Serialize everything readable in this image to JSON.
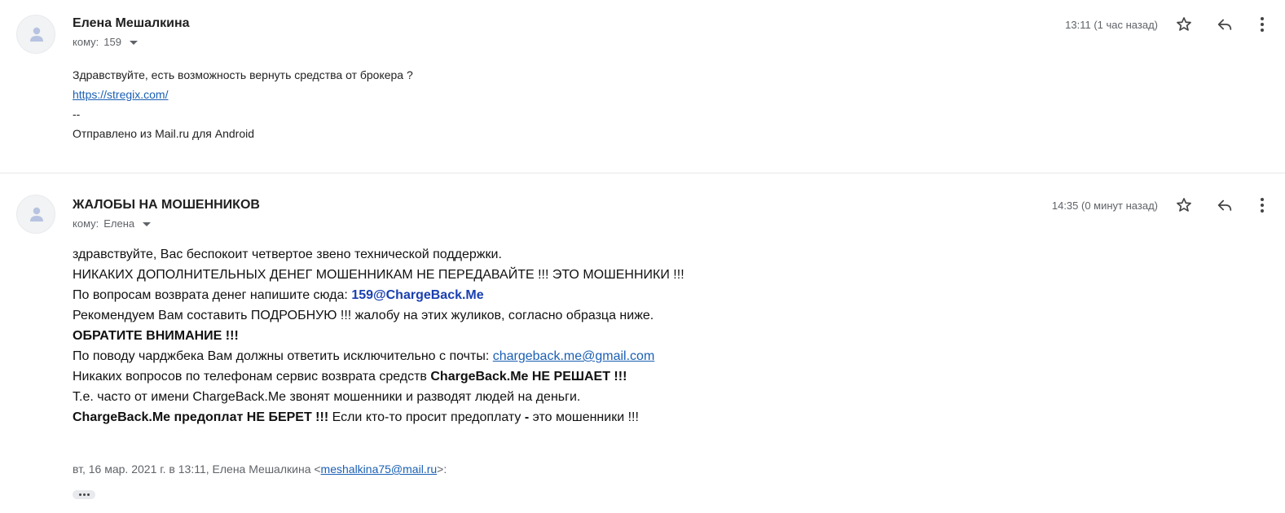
{
  "messages": [
    {
      "sender": "Елена Мешалкина",
      "recipient_prefix": "кому:",
      "recipient": "159",
      "timestamp": "13:11 (1 час назад)",
      "body": {
        "line1": "Здравствуйте, есть возможность вернуть средства от брокера ?",
        "link": "https://stregix.com/",
        "separator": "--",
        "signature": "Отправлено из Mail.ru для Android"
      }
    },
    {
      "sender": "ЖАЛОБЫ НА МОШЕННИКОВ",
      "recipient_prefix": "кому:",
      "recipient": "Елена",
      "timestamp": "14:35 (0 минут назад)",
      "body": {
        "line1": "здравствуйте, Вас беспокоит четвертое звено технической поддержки.",
        "line2": "НИКАКИХ ДОПОЛНИТЕЛЬНЫХ ДЕНЕГ МОШЕННИКАМ НЕ ПЕРЕДАВАЙТЕ !!! ЭТО МОШЕННИКИ !!!",
        "line3_prefix": "По вопросам возврата денег напишите сюда: ",
        "line3_email": "159@ChargeBack.Me",
        "line4": "Рекомендуем Вам составить ПОДРОБНУЮ !!! жалобу на этих жуликов, согласно образца ниже.",
        "line5": "ОБРАТИТЕ ВНИМАНИЕ !!!",
        "line6_prefix": "По поводу чарджбека Вам должны ответить исключительно с почты: ",
        "line6_email": "chargeback.me@gmail.com",
        "line7_prefix": "Никаких вопросов по телефонам сервис возврата средств ",
        "line7_bold": "ChargeBack.Me НЕ РЕШАЕТ !!!",
        "line8": "Т.е. часто от имени ChargeBack.Me звонят мошенники и разводят людей на деньги.",
        "line9_bold": "ChargeBack.Me предоплат НЕ БЕРЕТ !!!",
        "line9_mid": " Если кто-то просит предоплату ",
        "line9_dash": "-",
        "line9_end": " это мошенники !!!"
      },
      "quote": {
        "prefix": "вт, 16 мар. 2021 г. в 13:11, Елена Мешалкина <",
        "email": "meshalkina75@mail.ru",
        "suffix": ">:"
      }
    }
  ],
  "icons": {
    "avatar": "person-icon",
    "star": "star-icon",
    "reply": "reply-icon",
    "more": "more-vert-icon",
    "caret": "chevron-down-icon",
    "expand": "ellipsis-icon"
  },
  "colors": {
    "link": "#1a5fb4",
    "email_highlight": "#1a3fb0",
    "meta_text": "#5f6368",
    "divider": "#e6e6e6"
  }
}
